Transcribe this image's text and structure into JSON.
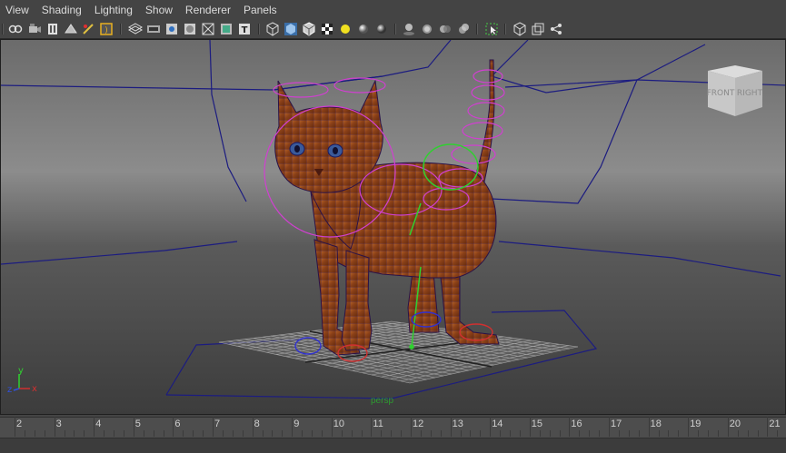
{
  "menubar": {
    "items": [
      {
        "label": "View"
      },
      {
        "label": "Shading"
      },
      {
        "label": "Lighting"
      },
      {
        "label": "Show"
      },
      {
        "label": "Renderer"
      },
      {
        "label": "Panels"
      }
    ]
  },
  "toolbar": {
    "icons": [
      "select-camera-icon",
      "camera-attributes-icon",
      "bookmarks-icon",
      "image-plane-icon",
      "grease-pencil-icon",
      "frame-selection-icon",
      "grid-icon",
      "film-gate-icon",
      "resolution-gate-icon",
      "gate-mask-icon",
      "field-chart-icon",
      "safe-action-icon",
      "safe-title-icon",
      "wireframe-icon",
      "smooth-shade-icon",
      "wireframe-on-shaded-icon",
      "textured-icon",
      "use-all-lights-icon",
      "shadows-icon",
      "screen-space-ao-icon",
      "motion-blur-icon",
      "multisample-aa-icon",
      "depth-of-field-icon",
      "isolate-select-icon",
      "xray-icon",
      "xray-joints-icon",
      "xray-components-icon"
    ]
  },
  "viewport": {
    "camera_label": "persp",
    "view_cube": {
      "front_label": "FRONT",
      "right_label": "RIGHT"
    },
    "axis": {
      "x": "x",
      "y": "y",
      "z": "z"
    }
  },
  "timeline": {
    "frames": [
      "2",
      "3",
      "4",
      "5",
      "6",
      "7",
      "8",
      "9",
      "10",
      "11",
      "12",
      "13",
      "14",
      "15",
      "16",
      "17",
      "18",
      "19",
      "20",
      "21"
    ]
  },
  "colors": {
    "ui_background": "#444444",
    "viewport_gradient_top": "#6f6f6f",
    "viewport_gradient_bottom": "#3e3e3e",
    "grid": "#8a8a8a",
    "cage_lines": "#1a1a8a",
    "ik_handles": "#cc33cc",
    "controls_green": "#33dd33",
    "cat_fur": "#a0522d"
  }
}
